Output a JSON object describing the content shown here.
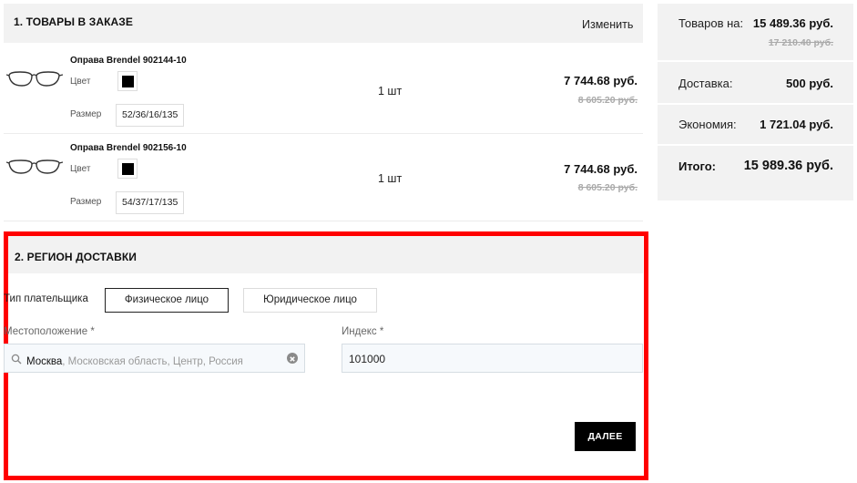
{
  "order_items": {
    "title": "1. ТОВАРЫ В ЗАКАЗЕ",
    "change_label": "Изменить",
    "items": [
      {
        "image_icon": "eyeglasses-frame",
        "name": "Оправа Brendel 902144-10",
        "color_label": "Цвет",
        "color_value": "#000000",
        "size_label": "Размер",
        "size_value": "52/36/16/135",
        "quantity": "1 шт",
        "price": "7 744.68 руб.",
        "old_price": "8 605.20 руб."
      },
      {
        "image_icon": "eyeglasses-frame",
        "name": "Оправа Brendel 902156-10",
        "color_label": "Цвет",
        "color_value": "#000000",
        "size_label": "Размер",
        "size_value": "54/37/17/135",
        "quantity": "1 шт",
        "price": "7 744.68 руб.",
        "old_price": "8 605.20 руб."
      }
    ]
  },
  "summary": {
    "goods_label": "Товаров на:",
    "goods_value": "15 489.36 руб.",
    "goods_old_value": "17 210.40 руб.",
    "delivery_label": "Доставка:",
    "delivery_value": "500 руб.",
    "savings_label": "Экономия:",
    "savings_value": "1 721.04 руб.",
    "total_label": "Итого:",
    "total_value": "15 989.36 руб."
  },
  "delivery_region": {
    "title": "2. РЕГИОН ДОСТАВКИ",
    "payer_type_label": "Тип плательщика",
    "payer_options": [
      "Физическое лицо",
      "Юридическое лицо"
    ],
    "payer_selected": "Физическое лицо",
    "location_label": "Местоположение *",
    "location_city": "Москва",
    "location_rest": ", Московская область, Центр, Россия",
    "index_label": "Индекс *",
    "index_value": "101000",
    "next_button": "ДАЛЕЕ"
  },
  "colors": {
    "highlight_frame": "#ff0000",
    "panel_bg": "#f2f2f2",
    "next_button_bg": "#000000"
  }
}
